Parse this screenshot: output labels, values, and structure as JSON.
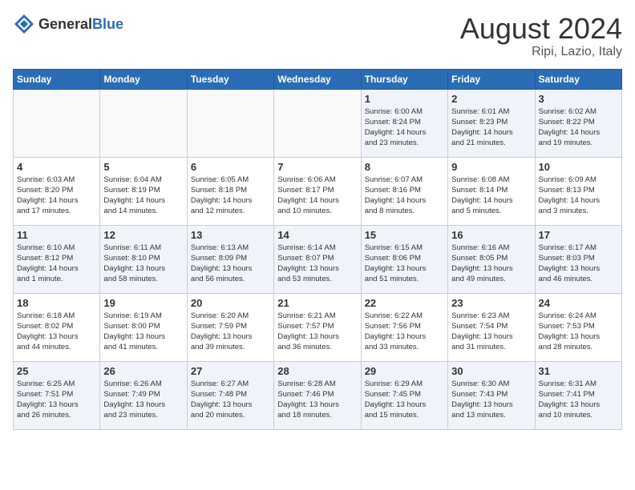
{
  "logo": {
    "general": "General",
    "blue": "Blue"
  },
  "header": {
    "month": "August 2024",
    "location": "Ripi, Lazio, Italy"
  },
  "weekdays": [
    "Sunday",
    "Monday",
    "Tuesday",
    "Wednesday",
    "Thursday",
    "Friday",
    "Saturday"
  ],
  "weeks": [
    [
      {
        "day": "",
        "text": ""
      },
      {
        "day": "",
        "text": ""
      },
      {
        "day": "",
        "text": ""
      },
      {
        "day": "",
        "text": ""
      },
      {
        "day": "1",
        "text": "Sunrise: 6:00 AM\nSunset: 8:24 PM\nDaylight: 14 hours\nand 23 minutes."
      },
      {
        "day": "2",
        "text": "Sunrise: 6:01 AM\nSunset: 8:23 PM\nDaylight: 14 hours\nand 21 minutes."
      },
      {
        "day": "3",
        "text": "Sunrise: 6:02 AM\nSunset: 8:22 PM\nDaylight: 14 hours\nand 19 minutes."
      }
    ],
    [
      {
        "day": "4",
        "text": "Sunrise: 6:03 AM\nSunset: 8:20 PM\nDaylight: 14 hours\nand 17 minutes."
      },
      {
        "day": "5",
        "text": "Sunrise: 6:04 AM\nSunset: 8:19 PM\nDaylight: 14 hours\nand 14 minutes."
      },
      {
        "day": "6",
        "text": "Sunrise: 6:05 AM\nSunset: 8:18 PM\nDaylight: 14 hours\nand 12 minutes."
      },
      {
        "day": "7",
        "text": "Sunrise: 6:06 AM\nSunset: 8:17 PM\nDaylight: 14 hours\nand 10 minutes."
      },
      {
        "day": "8",
        "text": "Sunrise: 6:07 AM\nSunset: 8:16 PM\nDaylight: 14 hours\nand 8 minutes."
      },
      {
        "day": "9",
        "text": "Sunrise: 6:08 AM\nSunset: 8:14 PM\nDaylight: 14 hours\nand 5 minutes."
      },
      {
        "day": "10",
        "text": "Sunrise: 6:09 AM\nSunset: 8:13 PM\nDaylight: 14 hours\nand 3 minutes."
      }
    ],
    [
      {
        "day": "11",
        "text": "Sunrise: 6:10 AM\nSunset: 8:12 PM\nDaylight: 14 hours\nand 1 minute."
      },
      {
        "day": "12",
        "text": "Sunrise: 6:11 AM\nSunset: 8:10 PM\nDaylight: 13 hours\nand 58 minutes."
      },
      {
        "day": "13",
        "text": "Sunrise: 6:13 AM\nSunset: 8:09 PM\nDaylight: 13 hours\nand 56 minutes."
      },
      {
        "day": "14",
        "text": "Sunrise: 6:14 AM\nSunset: 8:07 PM\nDaylight: 13 hours\nand 53 minutes."
      },
      {
        "day": "15",
        "text": "Sunrise: 6:15 AM\nSunset: 8:06 PM\nDaylight: 13 hours\nand 51 minutes."
      },
      {
        "day": "16",
        "text": "Sunrise: 6:16 AM\nSunset: 8:05 PM\nDaylight: 13 hours\nand 49 minutes."
      },
      {
        "day": "17",
        "text": "Sunrise: 6:17 AM\nSunset: 8:03 PM\nDaylight: 13 hours\nand 46 minutes."
      }
    ],
    [
      {
        "day": "18",
        "text": "Sunrise: 6:18 AM\nSunset: 8:02 PM\nDaylight: 13 hours\nand 44 minutes."
      },
      {
        "day": "19",
        "text": "Sunrise: 6:19 AM\nSunset: 8:00 PM\nDaylight: 13 hours\nand 41 minutes."
      },
      {
        "day": "20",
        "text": "Sunrise: 6:20 AM\nSunset: 7:59 PM\nDaylight: 13 hours\nand 39 minutes."
      },
      {
        "day": "21",
        "text": "Sunrise: 6:21 AM\nSunset: 7:57 PM\nDaylight: 13 hours\nand 36 minutes."
      },
      {
        "day": "22",
        "text": "Sunrise: 6:22 AM\nSunset: 7:56 PM\nDaylight: 13 hours\nand 33 minutes."
      },
      {
        "day": "23",
        "text": "Sunrise: 6:23 AM\nSunset: 7:54 PM\nDaylight: 13 hours\nand 31 minutes."
      },
      {
        "day": "24",
        "text": "Sunrise: 6:24 AM\nSunset: 7:53 PM\nDaylight: 13 hours\nand 28 minutes."
      }
    ],
    [
      {
        "day": "25",
        "text": "Sunrise: 6:25 AM\nSunset: 7:51 PM\nDaylight: 13 hours\nand 26 minutes."
      },
      {
        "day": "26",
        "text": "Sunrise: 6:26 AM\nSunset: 7:49 PM\nDaylight: 13 hours\nand 23 minutes."
      },
      {
        "day": "27",
        "text": "Sunrise: 6:27 AM\nSunset: 7:48 PM\nDaylight: 13 hours\nand 20 minutes."
      },
      {
        "day": "28",
        "text": "Sunrise: 6:28 AM\nSunset: 7:46 PM\nDaylight: 13 hours\nand 18 minutes."
      },
      {
        "day": "29",
        "text": "Sunrise: 6:29 AM\nSunset: 7:45 PM\nDaylight: 13 hours\nand 15 minutes."
      },
      {
        "day": "30",
        "text": "Sunrise: 6:30 AM\nSunset: 7:43 PM\nDaylight: 13 hours\nand 13 minutes."
      },
      {
        "day": "31",
        "text": "Sunrise: 6:31 AM\nSunset: 7:41 PM\nDaylight: 13 hours\nand 10 minutes."
      }
    ]
  ]
}
